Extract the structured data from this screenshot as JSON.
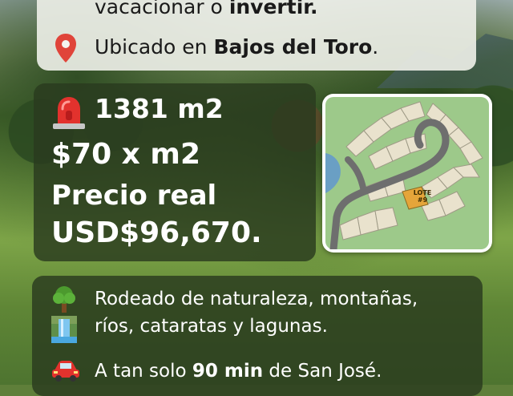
{
  "header": {
    "line1_prefix": "vacacionar o ",
    "line1_bold": "invertir.",
    "location_prefix": "Ubicado en ",
    "location_bold": "Bajos del Toro",
    "location_suffix": "."
  },
  "pricing": {
    "area": "1381 m2",
    "price_per_m2": "$70 x m2",
    "real_price_label": "Precio real",
    "real_price_value": "USD$96,670."
  },
  "site_map": {
    "lot_label": "LOTE",
    "lot_number": "#9",
    "lot_color": "#e5a53a"
  },
  "features": {
    "line1": "Rodeado de naturaleza, montañas,",
    "line2": "ríos, cataratas y lagunas.",
    "line3_prefix": "A tan solo ",
    "line3_bold": "90 min",
    "line3_suffix": " de San José."
  },
  "icons": {
    "location": "map-pin-icon",
    "alert": "siren-icon",
    "nature": "tree-icon",
    "waterfall": "waterfall-icon",
    "travel": "car-icon"
  },
  "colors": {
    "card_dark": "#2a3a1e",
    "card_light": "#eceee6",
    "pin_red": "#e0443a",
    "map_green": "#9dc98a"
  }
}
